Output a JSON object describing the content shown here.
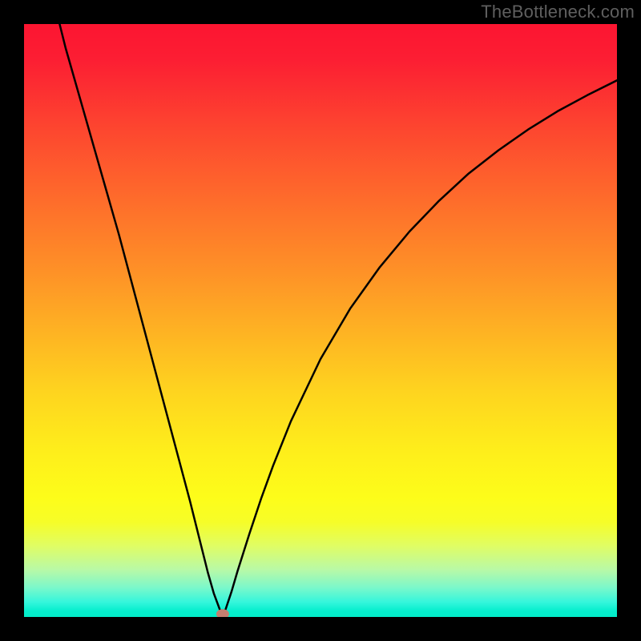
{
  "watermark_text": "TheBottleneck.com",
  "chart_data": {
    "type": "line",
    "title": "",
    "xlabel": "",
    "ylabel": "",
    "xlim": [
      0,
      100
    ],
    "ylim": [
      0,
      100
    ],
    "grid": false,
    "legend": false,
    "annotations": [
      {
        "kind": "min-marker",
        "x": 33.5,
        "y": 0.5
      }
    ],
    "series": [
      {
        "name": "bottleneck-curve",
        "color": "#000000",
        "x": [
          6,
          7,
          8,
          10,
          12,
          14,
          16,
          18,
          20,
          22,
          24,
          26,
          28,
          30,
          31,
          32,
          33,
          33.5,
          34,
          35,
          36,
          38,
          40,
          42,
          45,
          50,
          55,
          60,
          65,
          70,
          75,
          80,
          85,
          90,
          95,
          100
        ],
        "y": [
          100,
          96,
          92.5,
          85.5,
          78.5,
          71.5,
          64.5,
          57,
          49.5,
          42,
          34.5,
          27,
          19.5,
          11.5,
          7.5,
          4,
          1.3,
          0.3,
          1.3,
          4.3,
          7.7,
          14,
          20,
          25.5,
          33,
          43.5,
          52,
          59,
          65,
          70.2,
          74.8,
          78.7,
          82.2,
          85.3,
          88,
          90.5
        ]
      }
    ],
    "background_gradient_colors": [
      "#fc1531",
      "#fe6d2b",
      "#fed41f",
      "#fdfd1a",
      "#35f6dc",
      "#03ecc8"
    ]
  }
}
